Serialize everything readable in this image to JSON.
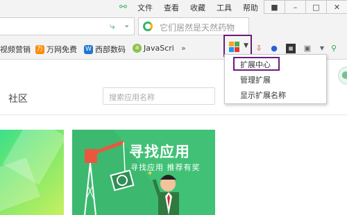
{
  "menubar": {
    "items": [
      "文件",
      "查看",
      "收藏",
      "工具",
      "帮助"
    ],
    "window_buttons": [
      "shirt-icon",
      "minimize-icon",
      "maximize-icon",
      "close-icon"
    ]
  },
  "address": {
    "search_placeholder": "它们居然是天然药物"
  },
  "bookmarks": [
    {
      "label": "视频营销",
      "icon": "none"
    },
    {
      "label": "万网免费",
      "icon": "wanwang-icon"
    },
    {
      "label": "西部数码",
      "icon": "west-icon"
    },
    {
      "label": "JavaScri",
      "icon": "android-icon"
    }
  ],
  "extension_menu": {
    "items": [
      "扩展中心",
      "管理扩展",
      "显示扩展名称"
    ],
    "highlighted": "扩展中心"
  },
  "page": {
    "tab_community": "社区",
    "app_search_placeholder": "搜索应用名称",
    "banner_title": "寻找应用",
    "banner_subtitle": "寻找应用 推荐有奖"
  },
  "colors": {
    "highlight_border": "#6a1b7a",
    "banner_green": "#3cb96f",
    "accent_green": "#36b36a"
  }
}
